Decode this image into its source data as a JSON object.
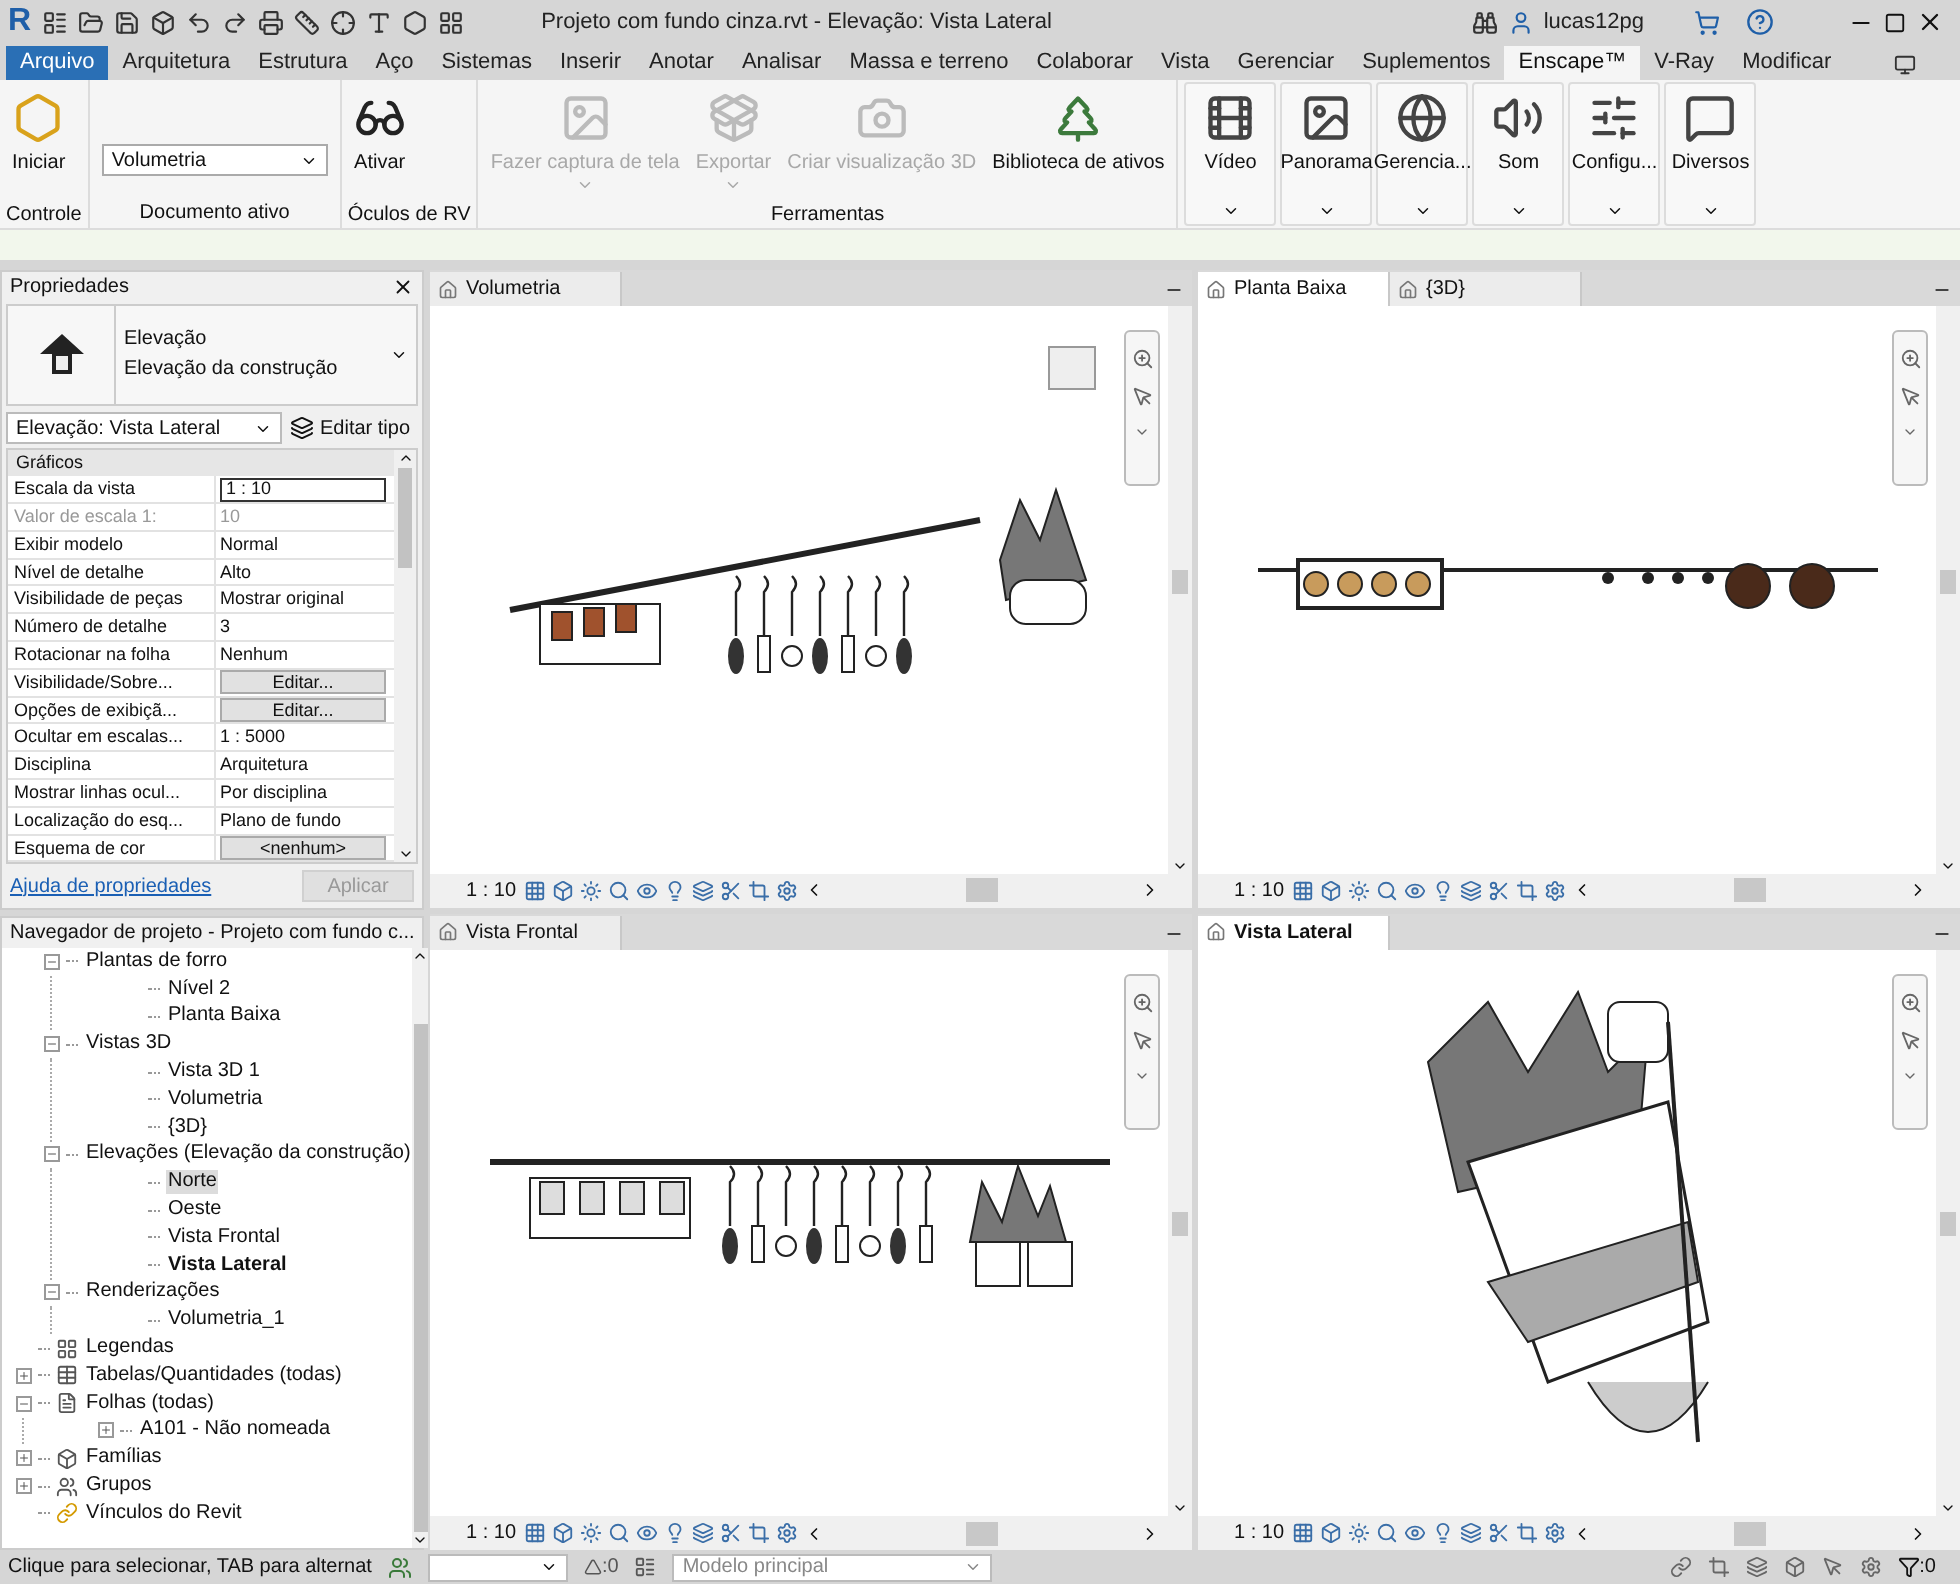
{
  "title_bar": {
    "logo": "R",
    "title": "Projeto com fundo cinza.rvt - Elevação: Vista Lateral",
    "user": "lucas12pg"
  },
  "ribbon_tabs": [
    {
      "label": "Arquivo",
      "kind": "file",
      "selected": false
    },
    {
      "label": "Arquitetura",
      "kind": "tab",
      "selected": false
    },
    {
      "label": "Estrutura",
      "kind": "tab",
      "selected": false
    },
    {
      "label": "Aço",
      "kind": "tab",
      "selected": false
    },
    {
      "label": "Sistemas",
      "kind": "tab",
      "selected": false
    },
    {
      "label": "Inserir",
      "kind": "tab",
      "selected": false
    },
    {
      "label": "Anotar",
      "kind": "tab",
      "selected": false
    },
    {
      "label": "Analisar",
      "kind": "tab",
      "selected": false
    },
    {
      "label": "Massa e terreno",
      "kind": "tab",
      "selected": false
    },
    {
      "label": "Colaborar",
      "kind": "tab",
      "selected": false
    },
    {
      "label": "Vista",
      "kind": "tab",
      "selected": false
    },
    {
      "label": "Gerenciar",
      "kind": "tab",
      "selected": false
    },
    {
      "label": "Suplementos",
      "kind": "tab",
      "selected": false
    },
    {
      "label": "Enscape™",
      "kind": "tab",
      "selected": true
    },
    {
      "label": "V-Ray",
      "kind": "tab",
      "selected": false
    },
    {
      "label": "Modificar",
      "kind": "tab",
      "selected": false
    }
  ],
  "ribbon_panels": [
    {
      "title": "Controle",
      "kind": "buttons",
      "buttons": [
        {
          "label": "Iniciar",
          "disabled": false,
          "dropdown": false
        }
      ]
    },
    {
      "title": "Documento ativo",
      "kind": "select",
      "value": "Volumetria"
    },
    {
      "title": "Óculos de RV",
      "kind": "buttons",
      "buttons": [
        {
          "label": "Ativar",
          "disabled": false,
          "dropdown": false
        }
      ]
    },
    {
      "title": "Ferramentas",
      "kind": "buttons",
      "buttons": [
        {
          "label": "Fazer captura de tela",
          "disabled": true,
          "dropdown": true
        },
        {
          "label": "Exportar",
          "disabled": true,
          "dropdown": true
        },
        {
          "label": "Criar visualização 3D",
          "disabled": true,
          "dropdown": false
        },
        {
          "label": "Biblioteca de ativos",
          "disabled": false,
          "dropdown": false
        }
      ]
    },
    {
      "kind": "boxed",
      "buttons": [
        {
          "label": "Vídeo",
          "disabled": false,
          "dropdown": true
        },
        {
          "label": "Panorama",
          "disabled": false,
          "dropdown": true
        },
        {
          "label": "Gerencia...",
          "disabled": false,
          "dropdown": true
        },
        {
          "label": "Som",
          "disabled": false,
          "dropdown": true
        },
        {
          "label": "Configu...",
          "disabled": false,
          "dropdown": true
        },
        {
          "label": "Diversos",
          "disabled": false,
          "dropdown": true
        }
      ]
    }
  ],
  "properties": {
    "title": "Propriedades",
    "type_lines": [
      "Elevação",
      "Elevação da construção"
    ],
    "selector": "Elevação: Vista Lateral",
    "edit_type": "Editar tipo",
    "group": "Gráficos",
    "rows": [
      {
        "label": "Escala da vista",
        "value": "1 : 10",
        "kind": "input"
      },
      {
        "label": "Valor de escala    1:",
        "value": "10",
        "kind": "readonly"
      },
      {
        "label": "Exibir modelo",
        "value": "Normal",
        "kind": "text"
      },
      {
        "label": "Nível de detalhe",
        "value": "Alto",
        "kind": "text"
      },
      {
        "label": "Visibilidade de peças",
        "value": "Mostrar original",
        "kind": "text"
      },
      {
        "label": "Número de detalhe",
        "value": "3",
        "kind": "text"
      },
      {
        "label": "Rotacionar na folha",
        "value": "Nenhum",
        "kind": "text"
      },
      {
        "label": "Visibilidade/Sobre...",
        "value": "Editar...",
        "kind": "button"
      },
      {
        "label": "Opções de exibiçã...",
        "value": "Editar...",
        "kind": "button"
      },
      {
        "label": "Ocultar em escalas...",
        "value": "1 : 5000",
        "kind": "text"
      },
      {
        "label": "Disciplina",
        "value": "Arquitetura",
        "kind": "text"
      },
      {
        "label": "Mostrar linhas ocul...",
        "value": "Por disciplina",
        "kind": "text"
      },
      {
        "label": "Localização do esq...",
        "value": "Plano de fundo",
        "kind": "text"
      },
      {
        "label": "Esquema de cor",
        "value": "<nenhum>",
        "kind": "button"
      }
    ],
    "help_link": "Ajuda de propriedades",
    "apply_button": {
      "label": "Aplicar",
      "disabled": true
    }
  },
  "project_browser": {
    "title": "Navegador de projeto - Projeto com fundo c...",
    "tree": [
      {
        "label": "Plantas de forro",
        "kind": "views",
        "expanded": true,
        "selected": false,
        "current": false,
        "children": [
          {
            "label": "Nível 2",
            "selected": false,
            "current": false
          },
          {
            "label": "Planta Baixa",
            "selected": false,
            "current": false
          }
        ]
      },
      {
        "label": "Vistas 3D",
        "kind": "views",
        "expanded": true,
        "selected": false,
        "current": false,
        "children": [
          {
            "label": "Vista 3D 1",
            "selected": false,
            "current": false
          },
          {
            "label": "Volumetria",
            "selected": false,
            "current": false
          },
          {
            "label": "{3D}",
            "selected": false,
            "current": false
          }
        ]
      },
      {
        "label": "Elevações (Elevação da construção)",
        "kind": "views",
        "expanded": true,
        "selected": false,
        "current": false,
        "children": [
          {
            "label": "Norte",
            "selected": true,
            "current": false
          },
          {
            "label": "Oeste",
            "selected": false,
            "current": false
          },
          {
            "label": "Vista Frontal",
            "selected": false,
            "current": false
          },
          {
            "label": "Vista Lateral",
            "selected": false,
            "current": true
          }
        ]
      },
      {
        "label": "Renderizações",
        "kind": "views",
        "expanded": true,
        "selected": false,
        "current": false,
        "children": [
          {
            "label": "Volumetria_1",
            "selected": false,
            "current": false
          }
        ]
      },
      {
        "label": "Legendas",
        "kind": "legend",
        "selected": false,
        "current": false
      },
      {
        "label": "Tabelas/Quantidades (todas)",
        "kind": "table",
        "expanded": false,
        "selected": false,
        "current": false
      },
      {
        "label": "Folhas (todas)",
        "kind": "sheet",
        "expanded": true,
        "selected": false,
        "current": false,
        "children": [
          {
            "label": "A101 - Não nomeada",
            "expanded": false,
            "selected": false,
            "current": false
          }
        ]
      },
      {
        "label": "Famílias",
        "kind": "family",
        "expanded": false,
        "selected": false,
        "current": false
      },
      {
        "label": "Grupos",
        "kind": "group",
        "expanded": false,
        "selected": false,
        "current": false
      },
      {
        "label": "Vínculos do Revit",
        "kind": "link",
        "selected": false,
        "current": false
      }
    ]
  },
  "views": [
    {
      "tabs": [
        {
          "label": "Volumetria",
          "selected": false
        }
      ],
      "active": false,
      "scale": "1 : 10"
    },
    {
      "tabs": [
        {
          "label": "Planta Baixa",
          "selected": true
        },
        {
          "label": "{3D}",
          "selected": false
        }
      ],
      "active": false,
      "scale": "1 : 10"
    },
    {
      "tabs": [
        {
          "label": "Vista Frontal",
          "selected": false
        }
      ],
      "active": false,
      "scale": "1 : 10"
    },
    {
      "tabs": [
        {
          "label": "Vista Lateral",
          "selected": true
        }
      ],
      "active": true,
      "scale": "1 : 10"
    }
  ],
  "status_bar": {
    "hint": "Clique para selecionar, TAB para alternat",
    "workset_count": ":0",
    "model": "Modelo principal",
    "filter_count": ":0"
  }
}
